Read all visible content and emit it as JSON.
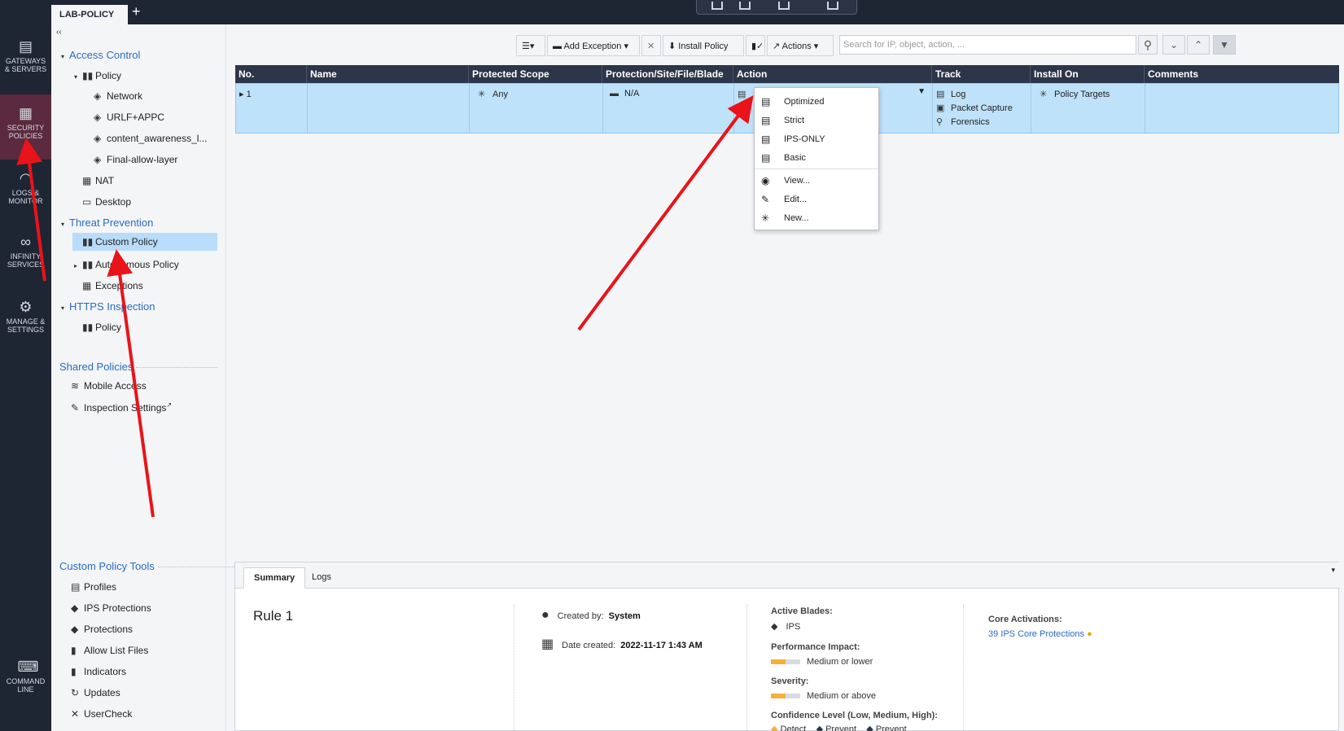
{
  "window": {
    "tab_label": "LAB-POLICY",
    "add_tab": "+"
  },
  "leftnav": [
    {
      "label1": "GATEWAYS",
      "label2": "& SERVERS"
    },
    {
      "label1": "SECURITY",
      "label2": "POLICIES"
    },
    {
      "label1": "LOGS &",
      "label2": "MONITOR"
    },
    {
      "label1": "INFINITY",
      "label2": "SERVICES"
    },
    {
      "label1": "MANAGE &",
      "label2": "SETTINGS"
    },
    {
      "label1": "COMMAND",
      "label2": "LINE"
    }
  ],
  "tree": {
    "collapse": "‹‹",
    "access_control": "Access Control",
    "policy": "Policy",
    "network": "Network",
    "urlf": "URLF+APPC",
    "content_awareness": "content_awareness_l...",
    "final_allow": "Final-allow-layer",
    "nat": "NAT",
    "desktop": "Desktop",
    "threat_prevention": "Threat Prevention",
    "custom_policy": "Custom Policy",
    "autonomous_policy": "Autonomous Policy",
    "exceptions": "Exceptions",
    "https_inspection": "HTTPS Inspection",
    "https_policy": "Policy",
    "shared_policies": "Shared Policies",
    "mobile_access": "Mobile Access",
    "inspection_settings": "Inspection Settings",
    "custom_policy_tools": "Custom Policy Tools",
    "tools": [
      "Profiles",
      "IPS Protections",
      "Protections",
      "Allow List Files",
      "Indicators",
      "Updates",
      "UserCheck"
    ]
  },
  "toolbar": {
    "add_exception": "Add Exception ▾",
    "install_policy": "Install Policy",
    "actions": "Actions ▾",
    "search_placeholder": "Search for IP, object, action, ..."
  },
  "table": {
    "headers": [
      "No.",
      "Name",
      "Protected Scope",
      "Protection/Site/File/Blade",
      "Action",
      "Track",
      "Install On",
      "Comments"
    ],
    "row": {
      "no": "1",
      "scope": "Any",
      "protection": "N/A",
      "track": [
        "Log",
        "Packet Capture",
        "Forensics"
      ],
      "install_on": "Policy Targets"
    }
  },
  "menu": {
    "items": [
      "Optimized",
      "Strict",
      "IPS-ONLY",
      "Basic",
      "View...",
      "Edit...",
      "New..."
    ]
  },
  "bottom": {
    "tabs": [
      "Summary",
      "Logs"
    ],
    "rule_title": "Rule 1",
    "created_by_label": "Created by:",
    "created_by": "System",
    "date_created_label": "Date created:",
    "date_created": "2022-11-17 1:43 AM",
    "active_blades_label": "Active Blades:",
    "active_blade": "IPS",
    "perf_label": "Performance Impact:",
    "perf_value": "Medium or lower",
    "severity_label": "Severity:",
    "severity_value": "Medium or above",
    "confidence_label": "Confidence Level (Low, Medium, High):",
    "confidence_values": [
      "Detect",
      "Prevent",
      "Prevent"
    ],
    "core_label": "Core Activations:",
    "core_link": "39 IPS Core Protections"
  }
}
